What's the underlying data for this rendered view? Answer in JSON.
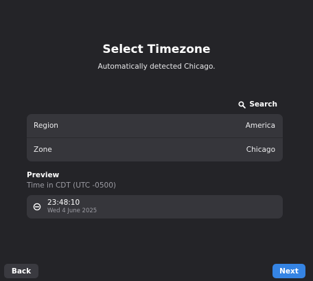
{
  "header": {
    "title": "Select Timezone",
    "subtitle": "Automatically detected Chicago."
  },
  "search": {
    "label": "Search",
    "icon": "search-icon"
  },
  "settings": {
    "rows": [
      {
        "label": "Region",
        "value": "America"
      },
      {
        "label": "Zone",
        "value": "Chicago"
      }
    ]
  },
  "preview": {
    "heading": "Preview",
    "caption": "Time in CDT (UTC -0500)",
    "time": "23:48:10",
    "date": "Wed 4 June 2025",
    "icon": "clock-icon"
  },
  "footer": {
    "back_label": "Back",
    "next_label": "Next"
  },
  "colors": {
    "background": "#242428",
    "card": "#36363b",
    "accent": "#3584e4",
    "secondary_button": "#3a3a40",
    "muted_text": "#9c9ca3"
  }
}
